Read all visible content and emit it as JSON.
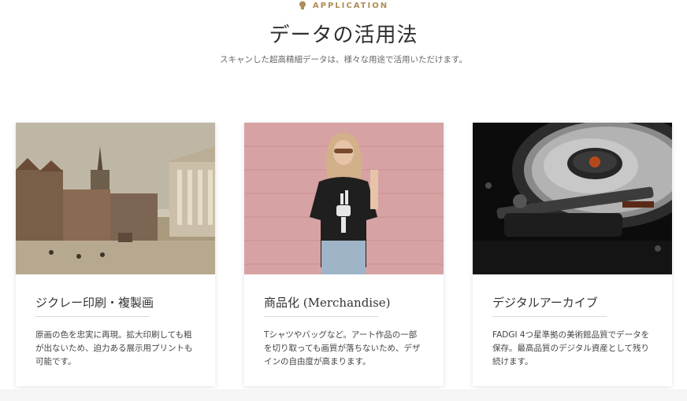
{
  "header": {
    "eyebrow_icon": "lightbulb-icon",
    "eyebrow": "APPLICATION",
    "title": "データの活用法",
    "subtitle": "スキャンした超高精細データは、様々な用途で活用いただけます。"
  },
  "cards": [
    {
      "image": "painting-of-old-european-town",
      "title": "ジクレー印刷・複製画",
      "body_lines": [
        "原画の色を忠実に再現。拡大印刷しても粗",
        "が出ないため、迫力ある展示用プリントも",
        "可能です。"
      ]
    },
    {
      "image": "woman-in-skeleton-hand-tshirt",
      "title": "商品化 (Merchandise)",
      "body_lines": [
        "Tシャツやバッグなど。アート作品の一部",
        "を切り取っても画質が落ちないため、デザ",
        "インの自由度が高まります。"
      ]
    },
    {
      "image": "hard-disk-drive-closeup",
      "title": "デジタルアーカイブ",
      "body_lines": [
        "FADGI 4つ星準拠の美術館品質でデータを",
        "保存。最高品質のデジタル資産として残り",
        "続けます。"
      ]
    }
  ],
  "colors": {
    "accent": "#b08d57",
    "title": "#2f2f2f",
    "body": "#444444"
  }
}
